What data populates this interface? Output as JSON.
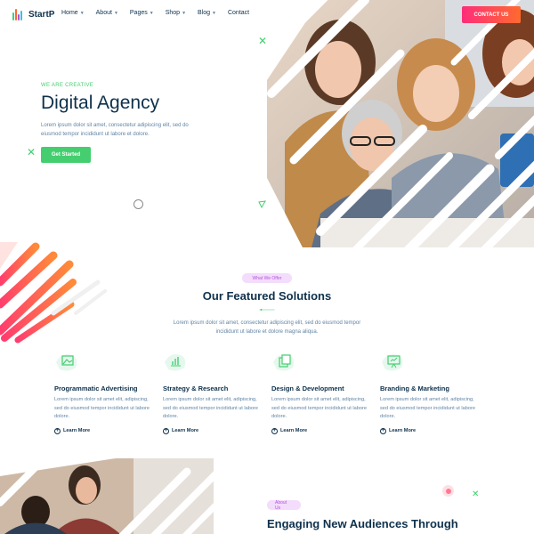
{
  "header": {
    "logo_text": "StartP",
    "nav": [
      {
        "label": "Home",
        "dropdown": true
      },
      {
        "label": "About",
        "dropdown": true
      },
      {
        "label": "Pages",
        "dropdown": true
      },
      {
        "label": "Shop",
        "dropdown": true
      },
      {
        "label": "Blog",
        "dropdown": true
      },
      {
        "label": "Contact",
        "dropdown": false
      }
    ],
    "contact_button": "CONTACT US"
  },
  "hero": {
    "kicker": "WE ARE CREATIVE",
    "title": "Digital Agency",
    "text": "Lorem ipsum dolor sit amet, consectetur adipiscing elit, sed do eiusmod tempor incididunt ut labore et dolore.",
    "button": "Get Started"
  },
  "features": {
    "pill": "What We Offer",
    "title": "Our Featured Solutions",
    "text": "Lorem ipsum dolor sit amet, consectetur adipiscing elit, sed do eiusmod tempor incididunt ut labore et dolore magna aliqua.",
    "cards": [
      {
        "title": "Programmatic Advertising",
        "text": "Lorem ipsum dolor sit amet elit, adipiscing, sed do eiusmod tempor incididunt ut labore dolore.",
        "link": "Learn More",
        "icon": "image-icon"
      },
      {
        "title": "Strategy & Research",
        "text": "Lorem ipsum dolor sit amet elit, adipiscing, sed do eiusmod tempor incididunt ut labore dolore.",
        "link": "Learn More",
        "icon": "bar-chart-icon"
      },
      {
        "title": "Design & Development",
        "text": "Lorem ipsum dolor sit amet elit, adipiscing, sed do eiusmod tempor incididunt ut labore dolore.",
        "link": "Learn More",
        "icon": "copy-icon"
      },
      {
        "title": "Branding & Marketing",
        "text": "Lorem ipsum dolor sit amet elit, adipiscing, sed do eiusmod tempor incididunt ut labore dolore.",
        "link": "Learn More",
        "icon": "presentation-icon"
      }
    ]
  },
  "about": {
    "pill": "About Us",
    "title": "Engaging New Audiences Through"
  },
  "colors": {
    "primary_text": "#0e314c",
    "body_text": "#6084a4",
    "accent_green": "#44ce6f",
    "pink": "#ff2d7a",
    "orange": "#ff6a2f",
    "pill_bg": "#f3dcfc",
    "pill_text": "#b056d9"
  }
}
